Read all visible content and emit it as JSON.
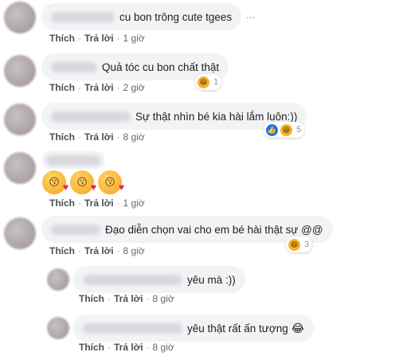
{
  "comments": [
    {
      "text": "cu bon trông cute tgees",
      "like": "Thích",
      "reply": "Trả lời",
      "time": "1 giờ",
      "more_icon": "more-horizontal-icon"
    },
    {
      "text": "Quả tóc cu bon chất thật",
      "like": "Thích",
      "reply": "Trả lời",
      "time": "2 giờ",
      "reaction_count": "1",
      "reactions": [
        "haha-icon"
      ]
    },
    {
      "text": "Sự thật nhìn bé kia hài lắm luôn:))",
      "like": "Thích",
      "reply": "Trả lời",
      "time": "8 giờ",
      "reaction_count": "5",
      "reactions": [
        "like-icon",
        "haha-icon"
      ]
    },
    {
      "text": "",
      "emojis": [
        "blowing-kiss-emoji",
        "blowing-kiss-emoji",
        "blowing-kiss-emoji"
      ],
      "like": "Thích",
      "reply": "Trả lời",
      "time": "1 giờ"
    },
    {
      "text": "Đạo diễn chọn vai cho em bé hài thật sự @@",
      "like": "Thích",
      "reply": "Trả lời",
      "time": "8 giờ",
      "reaction_count": "3",
      "reactions": [
        "haha-icon"
      ]
    }
  ],
  "replies": [
    {
      "text": "yêu mà :))",
      "like": "Thích",
      "reply": "Trả lời",
      "time": "8 giờ"
    },
    {
      "text": "yêu thật rất ấn tượng",
      "like": "Thích",
      "reply": "Trả lời",
      "time": "8 giờ",
      "inline_emoji": "😂"
    }
  ],
  "colors": {
    "bubble": "#f2f3f5",
    "link": "#4b4f56",
    "meta": "#616770",
    "like": "#1877f2",
    "haha": "#f7b125"
  }
}
